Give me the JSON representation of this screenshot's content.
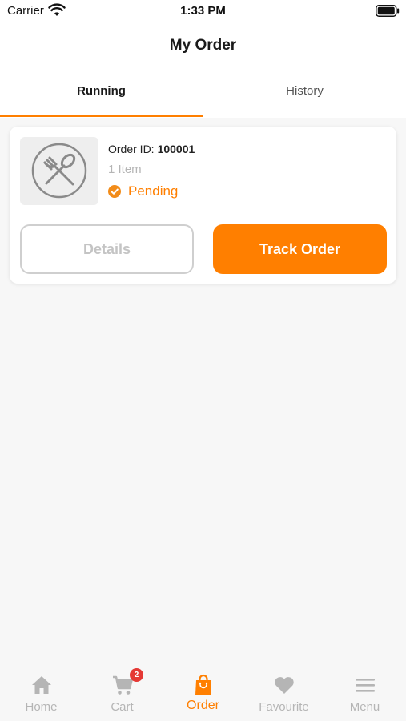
{
  "status_bar": {
    "carrier": "Carrier",
    "time": "1:33 PM"
  },
  "header": {
    "title": "My Order"
  },
  "tabs": [
    {
      "label": "Running",
      "active": true
    },
    {
      "label": "History",
      "active": false
    }
  ],
  "order": {
    "id_label": "Order ID:",
    "id_value": "100001",
    "item_count": "1 Item",
    "status": "Pending",
    "details_button": "Details",
    "track_button": "Track Order"
  },
  "bottom_nav": [
    {
      "label": "Home",
      "icon": "home-icon"
    },
    {
      "label": "Cart",
      "icon": "cart-icon",
      "badge": "2"
    },
    {
      "label": "Order",
      "icon": "bag-icon",
      "active": true
    },
    {
      "label": "Favourite",
      "icon": "heart-icon"
    },
    {
      "label": "Menu",
      "icon": "menu-icon"
    }
  ],
  "colors": {
    "accent": "#ff7f00",
    "inactive": "#b5b5b5",
    "badge": "#e53935"
  }
}
